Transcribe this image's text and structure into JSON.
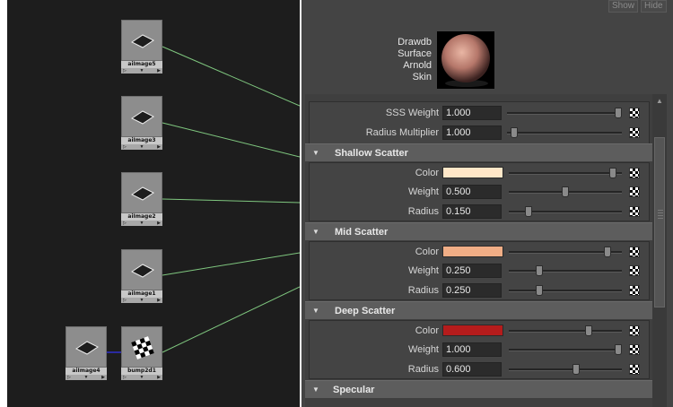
{
  "graph": {
    "nodes": [
      {
        "id": "aiImage5",
        "label": "aiImage5",
        "icon": "plane-icon"
      },
      {
        "id": "aiImage3",
        "label": "aiImage3",
        "icon": "plane-icon"
      },
      {
        "id": "aiImage2",
        "label": "aiImage2",
        "icon": "plane-icon"
      },
      {
        "id": "aiImage1",
        "label": "aiImage1",
        "icon": "plane-icon"
      },
      {
        "id": "aiImage4",
        "label": "aiImage4",
        "icon": "plane-icon"
      },
      {
        "id": "bump2d1",
        "label": "bump2d1",
        "icon": "checker-icon"
      }
    ],
    "wire_color": "#7fc77f",
    "aux_wire_color": "#2a2aa0"
  },
  "panel": {
    "top_buttons": {
      "show": "Show",
      "hide": "Hide"
    },
    "swatch_title": [
      "Drawdb",
      "Surface",
      "Arnold",
      "Skin"
    ],
    "sss_rows": [
      {
        "label": "SSS Weight",
        "value": "1.000",
        "level": 1.0
      },
      {
        "label": "Radius Multiplier",
        "value": "1.000",
        "level": 0.0
      }
    ],
    "sections": [
      {
        "title": "Shallow Scatter",
        "color": "#ffe7c8",
        "color_level": 0.95,
        "weight": "0.500",
        "weight_level": 0.5,
        "radius": "0.150",
        "radius_level": 0.15
      },
      {
        "title": "Mid Scatter",
        "color": "#f1ae86",
        "color_level": 0.9,
        "weight": "0.250",
        "weight_level": 0.25,
        "radius": "0.250",
        "radius_level": 0.25
      },
      {
        "title": "Deep Scatter",
        "color": "#b51c1c",
        "color_level": 0.72,
        "weight": "1.000",
        "weight_level": 1.0,
        "radius": "0.600",
        "radius_level": 0.6
      }
    ],
    "labels": {
      "color": "Color",
      "weight": "Weight",
      "radius": "Radius"
    },
    "specular_title": "Specular"
  }
}
